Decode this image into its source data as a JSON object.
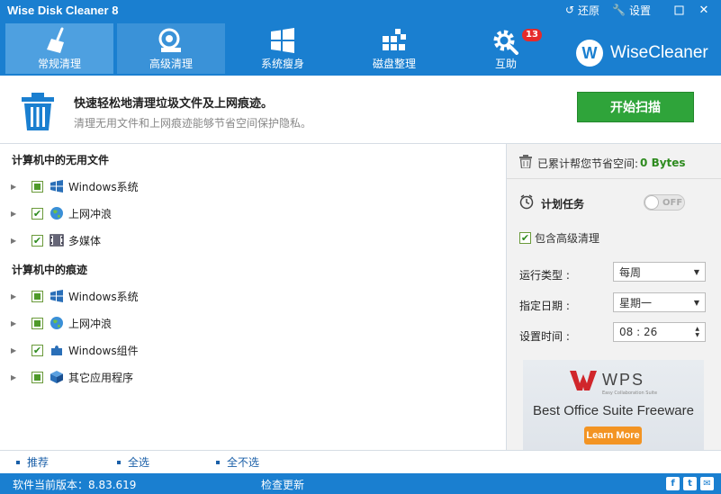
{
  "titlebar": {
    "title": "Wise Disk Cleaner 8",
    "restore": "还原",
    "settings": "设置",
    "min": "▫",
    "close": "✕"
  },
  "nav": {
    "tabs": [
      {
        "label": "常规清理",
        "icon": "broom-icon",
        "active": true
      },
      {
        "label": "高级清理",
        "icon": "vacuum-icon"
      },
      {
        "label": "系统瘦身",
        "icon": "windows-icon"
      },
      {
        "label": "磁盘整理",
        "icon": "blocks-icon"
      },
      {
        "label": "互助",
        "icon": "gear-wrench-icon",
        "badge": "13"
      }
    ],
    "brand": {
      "logo": "W",
      "name": "WiseCleaner"
    }
  },
  "hero": {
    "title": "快速轻松地清理垃圾文件及上网痕迹。",
    "subtitle": "清理无用文件和上网痕迹能够节省空间保护隐私。",
    "scan_button": "开始扫描"
  },
  "sections": [
    {
      "title": "计算机中的无用文件",
      "items": [
        {
          "label": "Windows系统",
          "state": "partial",
          "icon": "windows-flag-icon"
        },
        {
          "label": "上网冲浪",
          "state": "checked",
          "icon": "globe-icon"
        },
        {
          "label": "多媒体",
          "state": "checked",
          "icon": "film-icon"
        }
      ]
    },
    {
      "title": "计算机中的痕迹",
      "items": [
        {
          "label": "Windows系统",
          "state": "partial",
          "icon": "windows-flag-icon"
        },
        {
          "label": "上网冲浪",
          "state": "partial",
          "icon": "globe-icon"
        },
        {
          "label": "Windows组件",
          "state": "checked",
          "icon": "puzzle-icon"
        },
        {
          "label": "其它应用程序",
          "state": "partial",
          "icon": "box-icon"
        }
      ]
    }
  ],
  "right": {
    "saved_label": "已累计帮您节省空间:",
    "saved_value": "0 Bytes",
    "schedule_label": "计划任务",
    "toggle_label": "OFF",
    "include_advanced": "包含高级清理",
    "run_type_label": "运行类型 :",
    "run_type_value": "每周",
    "date_label": "指定日期 :",
    "date_value": "星期一",
    "time_label": "设置时间 :",
    "time_value": "08 : 26"
  },
  "ad": {
    "brand": "WPS",
    "tagline": "Easy Collaboration Suite",
    "title": "Best Office Suite Freeware",
    "button": "Learn More"
  },
  "bottom": {
    "recommend": "推荐",
    "select_all": "全选",
    "select_none": "全不选"
  },
  "status": {
    "version": "软件当前版本：8.83.619",
    "check_update": "检查更新"
  },
  "colors": {
    "primary": "#1a7fd0",
    "active_tab": "#4ea0e0",
    "scan_green": "#2fa43a",
    "badge_red": "#e52b2b",
    "saved_green": "#2e8b1f"
  }
}
